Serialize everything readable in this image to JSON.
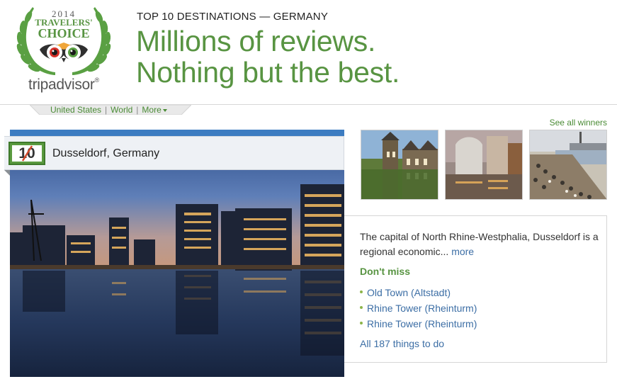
{
  "logo": {
    "year": "2014",
    "award_line1": "TRAVELERS'",
    "award_line2": "CHOICE",
    "brand": "tripadvisor",
    "brand_mark": "®",
    "icon": "owl-eyes-icon",
    "laurel": "laurel-wreath-icon"
  },
  "header": {
    "kicker": "TOP 10 DESTINATIONS — GERMANY",
    "headline_line1": "Millions of reviews.",
    "headline_line2": "Nothing but the best."
  },
  "nav": {
    "items": [
      "United States",
      "World",
      "More"
    ],
    "separator": "|"
  },
  "see_all": "See all winners",
  "destination": {
    "rank": "10",
    "name": "Dusseldorf, Germany",
    "description": "The capital of North Rhine-Westphalia, Dusseldorf is a regional economic...",
    "more_link": "more",
    "dont_miss_title": "Don't miss",
    "dont_miss": [
      "Old Town (Altstadt)",
      "Rhine Tower (Rheinturm)",
      "Rhine Tower (Rheinturm)"
    ],
    "all_things": "All 187 things to do"
  },
  "colors": {
    "brand_green": "#589442",
    "link_green": "#4a8b35",
    "link_blue": "#3c6ea5",
    "hero_bar": "#3c7cc1"
  }
}
